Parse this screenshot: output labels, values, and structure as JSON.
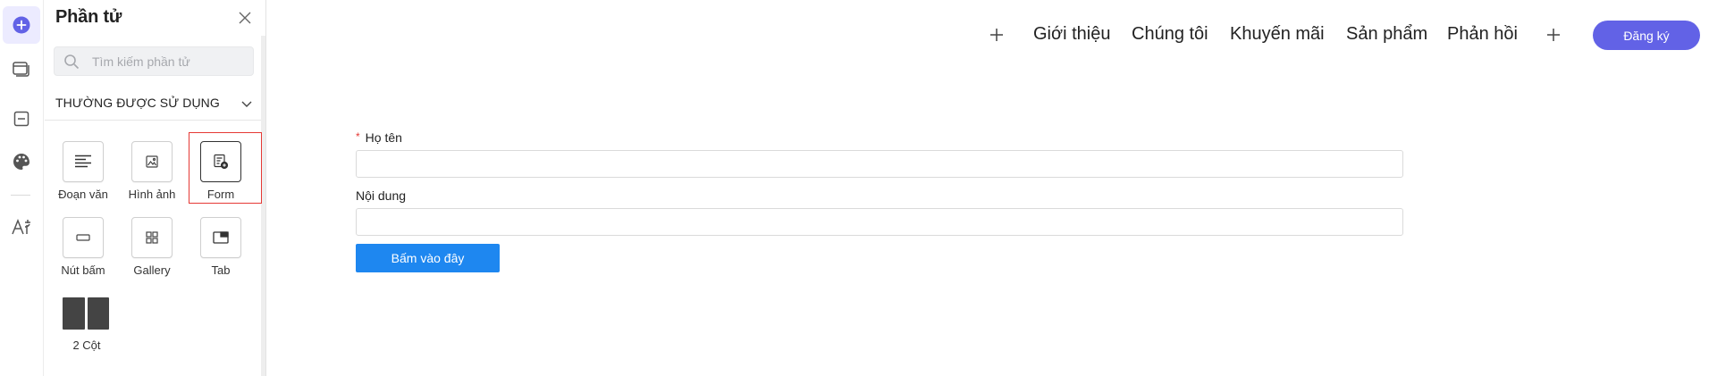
{
  "rail": {
    "items": [
      {
        "icon": "add-circle-icon",
        "active": true
      },
      {
        "icon": "layers-icon"
      },
      {
        "icon": "section-icon"
      },
      {
        "icon": "palette-icon"
      },
      {
        "icon": "typography-icon"
      }
    ],
    "accent": "#6262e6"
  },
  "panel": {
    "title": "Phần tử",
    "search_placeholder": "Tìm kiếm phần tử",
    "section_title": "THƯỜNG ĐƯỢC SỬ DỤNG",
    "tiles": [
      {
        "label": "Đoạn văn",
        "icon": "paragraph-icon"
      },
      {
        "label": "Hình ảnh",
        "icon": "image-icon"
      },
      {
        "label": "Form",
        "icon": "form-icon",
        "highlighted": true
      },
      {
        "label": "Nút bấm",
        "icon": "button-icon"
      },
      {
        "label": "Gallery",
        "icon": "gallery-icon"
      },
      {
        "label": "Tab",
        "icon": "tab-icon"
      },
      {
        "label": "2 Cột",
        "icon": "two-column-icon"
      }
    ]
  },
  "nav": {
    "links": [
      "Giới thiệu",
      "Chúng tôi",
      "Khuyến mãi",
      "Sản phẩm",
      "Phản hồi"
    ],
    "signup_label": "Đăng ký",
    "signup_color": "#6262e6"
  },
  "form": {
    "name_label": "Họ tên",
    "name_required_mark": "*",
    "content_label": "Nội dung",
    "submit_label": "Bấm vào đây",
    "submit_color": "#1e87f0"
  }
}
